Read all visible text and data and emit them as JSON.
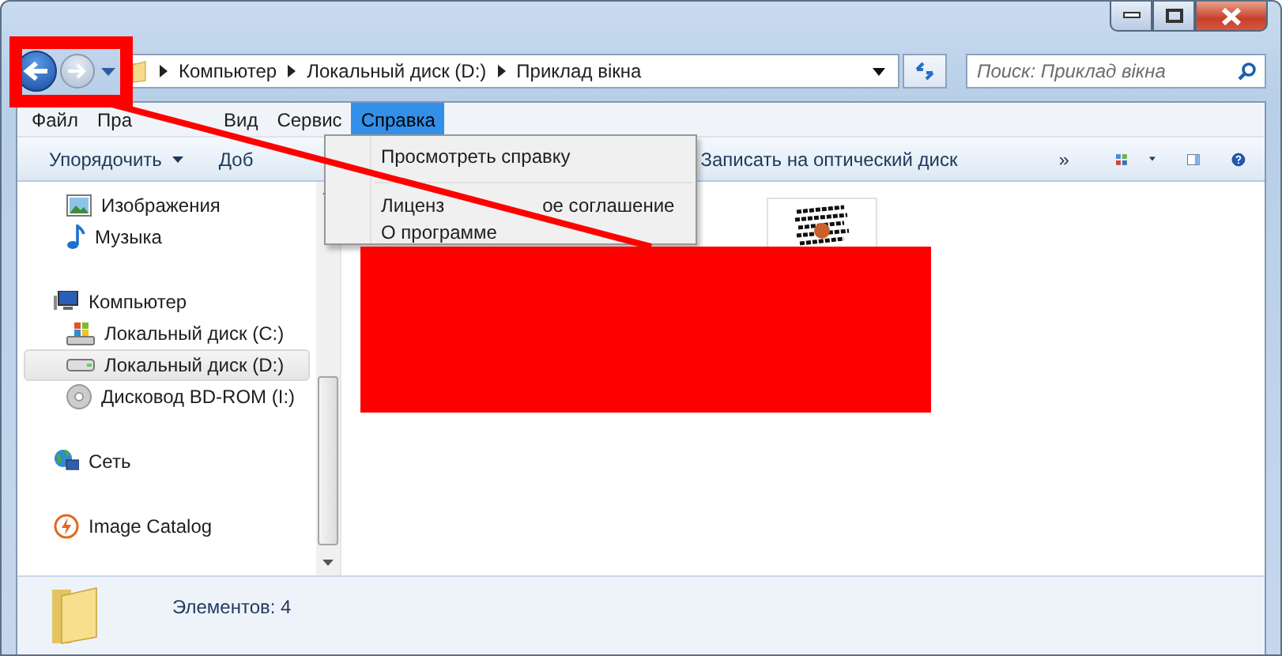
{
  "address_bar": {
    "path": [
      "Компьютер",
      "Локальный диск (D:)",
      "Приклад вікна"
    ]
  },
  "search": {
    "placeholder": "Поиск: Приклад вікна"
  },
  "menu_bar": [
    {
      "label": "Файл",
      "selected": false
    },
    {
      "label": "Пра",
      "selected": false
    },
    {
      "label": "Вид",
      "selected": false
    },
    {
      "label": "Сервис",
      "selected": false
    },
    {
      "label": "Справка",
      "selected": true
    }
  ],
  "open_menu": {
    "items": [
      {
        "label_parts": [
          "Просмотреть справку"
        ],
        "separator_after": true
      },
      {
        "label_parts": [
          "Лиценз",
          "ое соглашение"
        ],
        "separator_after": false
      },
      {
        "label_parts": [
          "О программе"
        ],
        "separator_after": false
      }
    ]
  },
  "toolbar": {
    "items": [
      {
        "label": "Упорядочить",
        "dropdown": true
      },
      {
        "label": "Доб",
        "dropdown": false
      },
      {
        "label": "Записать на оптический диск",
        "dropdown": false
      }
    ],
    "overflow": "»"
  },
  "nav": [
    {
      "children": [
        {
          "label": "Изображения",
          "kind": "pictures",
          "selected": false
        },
        {
          "label": "Музыка",
          "kind": "music",
          "selected": false
        }
      ]
    },
    {
      "label": "Компьютер",
      "kind": "computer",
      "selected": false,
      "children": [
        {
          "label": "Локальный диск (C:)",
          "kind": "system-drive",
          "selected": false
        },
        {
          "label": "Локальный диск (D:)",
          "kind": "drive",
          "selected": true
        },
        {
          "label": "Дисковод BD-ROM (I:)",
          "kind": "disc",
          "selected": false
        }
      ]
    },
    {
      "label": "Сеть",
      "kind": "network",
      "selected": false
    },
    {
      "label": "Image Catalog",
      "kind": "catalog",
      "selected": false
    }
  ],
  "files": [
    {
      "kind": "image"
    }
  ],
  "status_bar": {
    "count": "Элементов: 4"
  }
}
